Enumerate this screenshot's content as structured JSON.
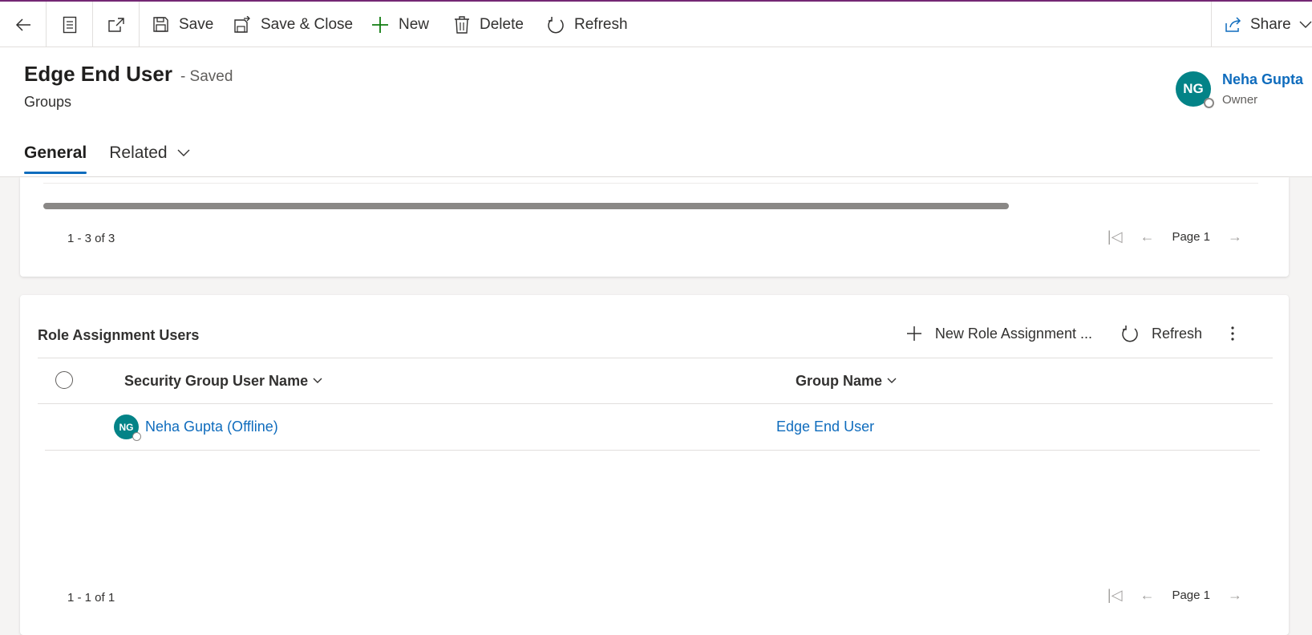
{
  "commandbar": {
    "save": "Save",
    "save_close": "Save & Close",
    "new": "New",
    "delete": "Delete",
    "refresh": "Refresh",
    "share": "Share"
  },
  "header": {
    "title": "Edge End User",
    "status": "- Saved",
    "entity": "Groups",
    "owner": {
      "initials": "NG",
      "name": "Neha Gupta",
      "role": "Owner"
    }
  },
  "tabs": [
    {
      "label": "General"
    },
    {
      "label": "Related"
    }
  ],
  "top_grid": {
    "count": "1 - 3 of 3",
    "page": "Page 1"
  },
  "role_assignment": {
    "title": "Role Assignment Users",
    "new_label": "New Role Assignment ...",
    "refresh_label": "Refresh",
    "columns": [
      "Security Group User Name",
      "Group Name"
    ],
    "rows": [
      {
        "initials": "NG",
        "user": "Neha Gupta (Offline)",
        "group": "Edge End User"
      }
    ],
    "count": "1 - 1 of 1",
    "page": "Page 1"
  },
  "colors": {
    "accent": "#0f6cbd",
    "avatar": "#038387",
    "brand_line": "#742774"
  }
}
